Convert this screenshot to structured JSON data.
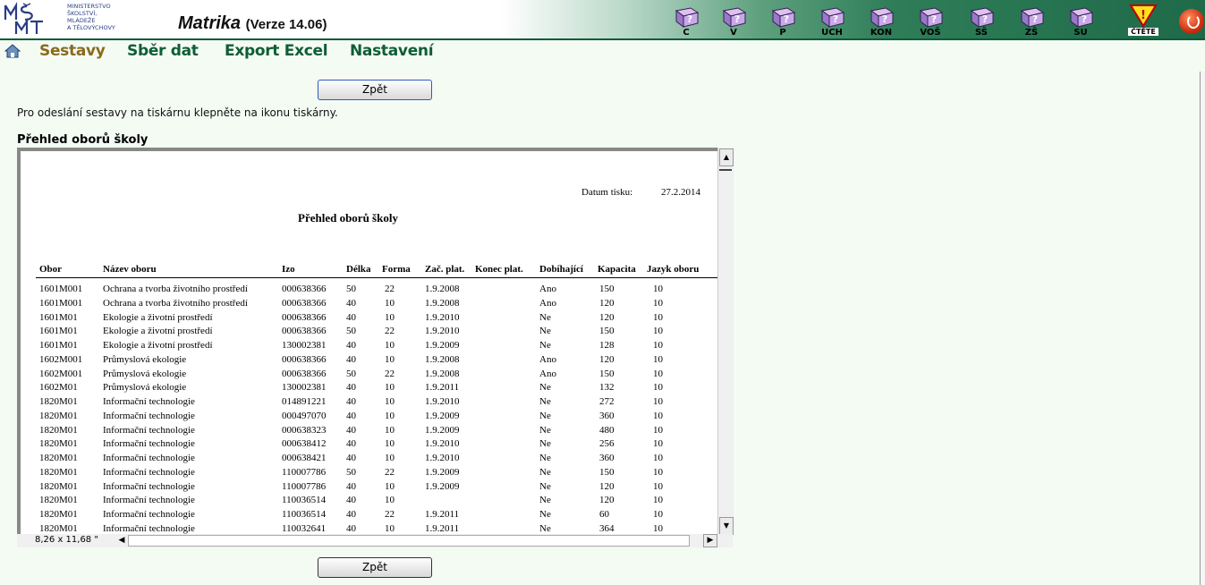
{
  "header": {
    "logo_text": [
      "MINISTERSTVO",
      "ŠKOLSTVÍ,",
      "MLÁDEŽE",
      "A TĚLOVÝCHOVY"
    ],
    "app_title": "Matrika",
    "app_version": "(Verze 14.06)",
    "toolbar": [
      {
        "label": "C",
        "icon": "book-c-icon"
      },
      {
        "label": "V",
        "icon": "book-v-icon"
      },
      {
        "label": "P",
        "icon": "book-p-icon"
      },
      {
        "label": "UCH",
        "icon": "book-uch-icon"
      },
      {
        "label": "KON",
        "icon": "book-kon-icon"
      },
      {
        "label": "VOŠ",
        "icon": "book-vos-icon"
      },
      {
        "label": "SŠ",
        "icon": "book-ss-icon"
      },
      {
        "label": "ZŠ",
        "icon": "book-zs-icon"
      },
      {
        "label": "SU",
        "icon": "book-su-icon"
      }
    ],
    "warning_label": "ČTĚTE"
  },
  "menu": {
    "items": [
      "Sestavy",
      "Sběr dat",
      "Export Excel",
      "Nastavení"
    ],
    "active": "Sestavy"
  },
  "back_button": "Zpět",
  "instruction": "Pro odeslání sestavy na tiskárnu klepněte na ikonu tiskárny.",
  "report_heading": "Přehled oborů školy",
  "viewer": {
    "page_size": "8,26 x 11,68 \""
  },
  "report": {
    "date_label": "Datum tisku:",
    "date_value": "27.2.2014",
    "title": "Přehled oborů školy",
    "columns": [
      "Obor",
      "Název oboru",
      "Izo",
      "Délka",
      "Forma",
      "Zač. plat.",
      "Konec plat.",
      "Dobíhající",
      "Kapacita",
      "Jazyk oboru"
    ],
    "rows": [
      [
        "1601M001",
        "Ochrana a tvorba životního prostředí",
        "000638366",
        "50",
        "22",
        "1.9.2008",
        "",
        "Ano",
        "150",
        "10"
      ],
      [
        "1601M001",
        "Ochrana a tvorba životního prostředí",
        "000638366",
        "40",
        "10",
        "1.9.2008",
        "",
        "Ano",
        "120",
        "10"
      ],
      [
        "1601M01",
        "Ekologie a životní prostředí",
        "000638366",
        "40",
        "10",
        "1.9.2010",
        "",
        "Ne",
        "120",
        "10"
      ],
      [
        "1601M01",
        "Ekologie a životní prostředí",
        "000638366",
        "50",
        "22",
        "1.9.2010",
        "",
        "Ne",
        "150",
        "10"
      ],
      [
        "1601M01",
        "Ekologie a životní prostředí",
        "130002381",
        "40",
        "10",
        "1.9.2009",
        "",
        "Ne",
        "128",
        "10"
      ],
      [
        "1602M001",
        "Průmyslová ekologie",
        "000638366",
        "40",
        "10",
        "1.9.2008",
        "",
        "Ano",
        "120",
        "10"
      ],
      [
        "1602M001",
        "Průmyslová ekologie",
        "000638366",
        "50",
        "22",
        "1.9.2008",
        "",
        "Ano",
        "150",
        "10"
      ],
      [
        "1602M01",
        "Průmyslová ekologie",
        "130002381",
        "40",
        "10",
        "1.9.2011",
        "",
        "Ne",
        "132",
        "10"
      ],
      [
        "1820M01",
        "Informační technologie",
        "014891221",
        "40",
        "10",
        "1.9.2010",
        "",
        "Ne",
        "272",
        "10"
      ],
      [
        "1820M01",
        "Informační technologie",
        "000497070",
        "40",
        "10",
        "1.9.2009",
        "",
        "Ne",
        "360",
        "10"
      ],
      [
        "1820M01",
        "Informační technologie",
        "000638323",
        "40",
        "10",
        "1.9.2009",
        "",
        "Ne",
        "480",
        "10"
      ],
      [
        "1820M01",
        "Informační technologie",
        "000638412",
        "40",
        "10",
        "1.9.2010",
        "",
        "Ne",
        "256",
        "10"
      ],
      [
        "1820M01",
        "Informační technologie",
        "000638421",
        "40",
        "10",
        "1.9.2010",
        "",
        "Ne",
        "360",
        "10"
      ],
      [
        "1820M01",
        "Informační technologie",
        "110007786",
        "50",
        "22",
        "1.9.2009",
        "",
        "Ne",
        "150",
        "10"
      ],
      [
        "1820M01",
        "Informační technologie",
        "110007786",
        "40",
        "10",
        "1.9.2009",
        "",
        "Ne",
        "120",
        "10"
      ],
      [
        "1820M01",
        "Informační technologie",
        "110036514",
        "40",
        "10",
        "",
        "",
        "Ne",
        "120",
        "10"
      ],
      [
        "1820M01",
        "Informační technologie",
        "110036514",
        "40",
        "22",
        "1.9.2011",
        "",
        "Ne",
        "60",
        "10"
      ],
      [
        "1820M01",
        "Informační technologie",
        "110032641",
        "40",
        "10",
        "1.9.2011",
        "",
        "Ne",
        "364",
        "10"
      ]
    ]
  }
}
